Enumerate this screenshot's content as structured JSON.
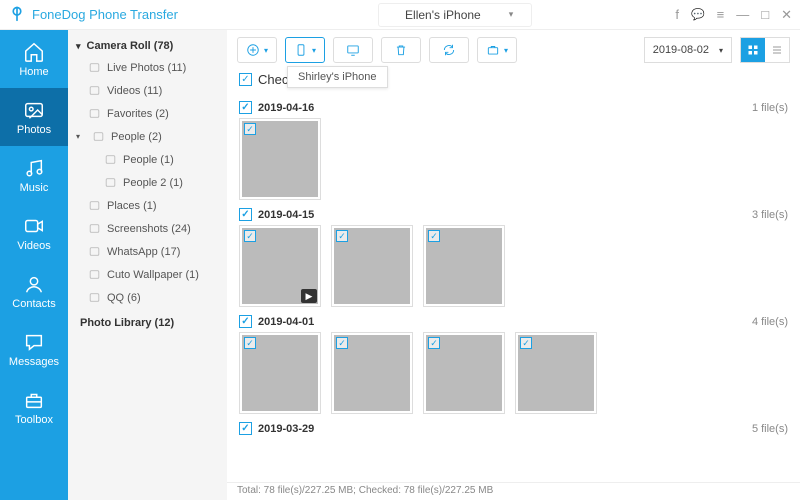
{
  "app_title": "FoneDog Phone Transfer",
  "device": {
    "name": "Ellen's iPhone",
    "brand_icon": "apple"
  },
  "nav": [
    {
      "key": "home",
      "label": "Home"
    },
    {
      "key": "photos",
      "label": "Photos"
    },
    {
      "key": "music",
      "label": "Music"
    },
    {
      "key": "videos",
      "label": "Videos"
    },
    {
      "key": "contacts",
      "label": "Contacts"
    },
    {
      "key": "messages",
      "label": "Messages"
    },
    {
      "key": "toolbox",
      "label": "Toolbox"
    }
  ],
  "nav_active": "photos",
  "sidebar": {
    "header": "Camera Roll (78)",
    "items": [
      {
        "label": "Live Photos (11)"
      },
      {
        "label": "Videos (11)"
      },
      {
        "label": "Favorites (2)"
      },
      {
        "label": "People (2)",
        "expanded": true,
        "children": [
          {
            "label": "People (1)"
          },
          {
            "label": "People 2 (1)"
          }
        ]
      },
      {
        "label": "Places (1)"
      },
      {
        "label": "Screenshots (24)"
      },
      {
        "label": "WhatsApp (17)"
      },
      {
        "label": "Cuto Wallpaper (1)"
      },
      {
        "label": "QQ (6)"
      }
    ],
    "footer": "Photo Library (12)"
  },
  "toolbar": {
    "tooltip": "Shirley's iPhone",
    "date_filter": "2019-08-02"
  },
  "check_all_label": "Check All(78)",
  "groups": [
    {
      "date": "2019-04-16",
      "count_label": "1 file(s)",
      "thumbs": [
        {
          "cls": "p-phone"
        }
      ]
    },
    {
      "date": "2019-04-15",
      "count_label": "3 file(s)",
      "thumbs": [
        {
          "cls": "p-mug",
          "video": true
        },
        {
          "cls": "p-drinks"
        },
        {
          "cls": "p-drinks"
        }
      ]
    },
    {
      "date": "2019-04-01",
      "count_label": "4 file(s)",
      "thumbs": [
        {
          "cls": "p-dog1"
        },
        {
          "cls": "p-dog2"
        },
        {
          "cls": "p-stage"
        },
        {
          "cls": "p-drinks"
        }
      ]
    },
    {
      "date": "2019-03-29",
      "count_label": "5 file(s)",
      "thumbs": []
    }
  ],
  "status": "Total: 78 file(s)/227.25 MB; Checked: 78 file(s)/227.25 MB"
}
